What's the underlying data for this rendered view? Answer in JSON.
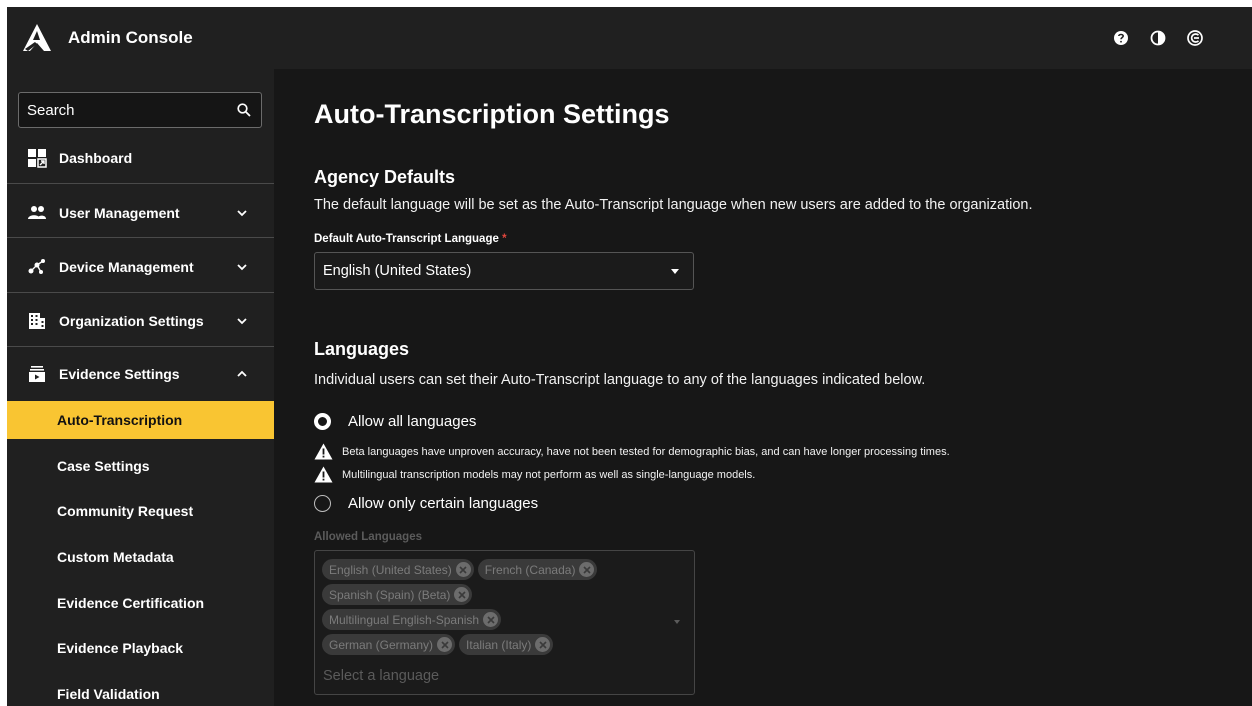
{
  "app": {
    "title": "Admin Console"
  },
  "sidebar": {
    "search_placeholder": "Search",
    "items": [
      {
        "label": "Dashboard",
        "icon": "dashboard-icon"
      },
      {
        "label": "User Management",
        "icon": "users-icon",
        "expanded": false
      },
      {
        "label": "Device Management",
        "icon": "device-icon",
        "expanded": false
      },
      {
        "label": "Organization Settings",
        "icon": "building-icon",
        "expanded": false
      },
      {
        "label": "Evidence Settings",
        "icon": "evidence-icon",
        "expanded": true
      }
    ],
    "sub_items": [
      {
        "label": "Auto-Transcription",
        "active": true
      },
      {
        "label": "Case Settings"
      },
      {
        "label": "Community Request"
      },
      {
        "label": "Custom Metadata"
      },
      {
        "label": "Evidence Certification"
      },
      {
        "label": "Evidence Playback"
      },
      {
        "label": "Field Validation"
      }
    ]
  },
  "topbar": {
    "icons": [
      "help-icon",
      "contrast-icon",
      "account-icon"
    ]
  },
  "page": {
    "title": "Auto-Transcription Settings",
    "agency": {
      "heading": "Agency Defaults",
      "description": "The default language will be set as the Auto-Transcript language when new users are added to the organization.",
      "field_label": "Default Auto-Transcript Language",
      "required_mark": "*",
      "field_value": "English (United States)"
    },
    "languages": {
      "heading": "Languages",
      "description": "Individual users can set their Auto-Transcript language to any of the languages indicated below.",
      "option_all": "Allow all languages",
      "option_certain": "Allow only certain languages",
      "selected_option": "all",
      "warnings": [
        "Beta languages have unproven accuracy, have not been tested for demographic bias, and can have longer processing times.",
        "Multilingual transcription models may not perform as well as single-language models."
      ],
      "allowed_label": "Allowed Languages",
      "allowed_chips": [
        "English (United States)",
        "French (Canada)",
        "Spanish (Spain) (Beta)",
        "Multilingual English-Spanish",
        "German (Germany)",
        "Italian (Italy)"
      ],
      "allowed_placeholder": "Select a language"
    }
  },
  "colors": {
    "accent": "#f9c532",
    "background": "#171717",
    "sidebar": "#202020",
    "required": "#e0463d"
  }
}
